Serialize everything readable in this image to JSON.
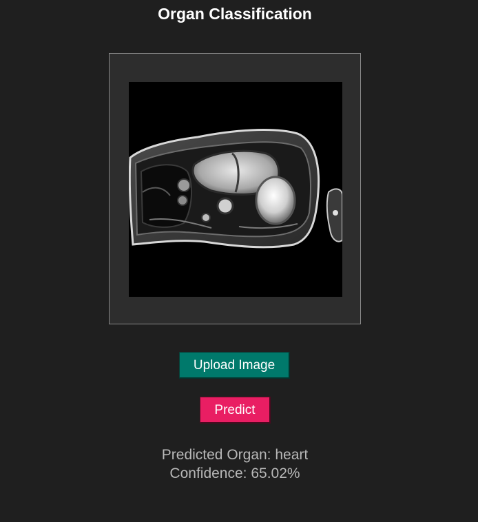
{
  "app": {
    "title": "Organ Classification"
  },
  "buttons": {
    "upload_label": "Upload Image",
    "predict_label": "Predict"
  },
  "result": {
    "predicted_organ_text": "Predicted Organ: heart",
    "confidence_text": "Confidence: 65.02%"
  },
  "colors": {
    "background": "#1f1f1f",
    "upload_button": "#00796b",
    "predict_button": "#e91e63",
    "result_text": "#b8b8b8"
  }
}
